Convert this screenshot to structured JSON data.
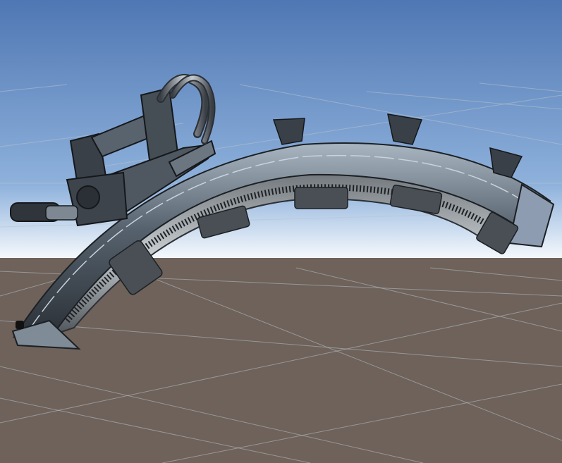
{
  "viewport": {
    "sky_top_color": "#4f77b3",
    "sky_mid_color": "#8fb2dc",
    "horizon_color": "#f4f8fc",
    "ground_color": "#6e625a",
    "grid_color": "#b9c2cc"
  },
  "model": {
    "metal_dark": "#2b3036",
    "metal_mid": "#55616d",
    "metal_light": "#a9b6c2",
    "accent_blue": "#3c6a9c"
  }
}
